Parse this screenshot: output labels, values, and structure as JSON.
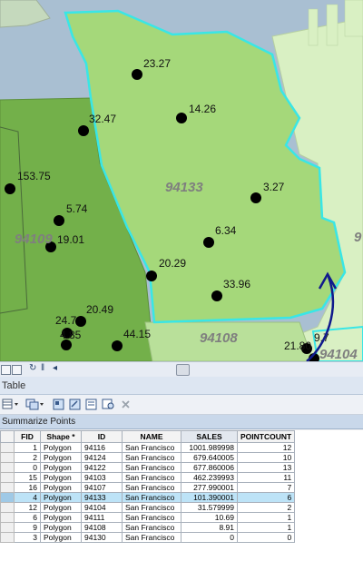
{
  "map": {
    "points": [
      {
        "label": "23.27"
      },
      {
        "label": "14.26"
      },
      {
        "label": "32.47"
      },
      {
        "label": "153.75"
      },
      {
        "label": "3.27"
      },
      {
        "label": "5.74"
      },
      {
        "label": "19.01"
      },
      {
        "label": "6.34"
      },
      {
        "label": "20.29"
      },
      {
        "label": "33.96"
      },
      {
        "label": "20.49"
      },
      {
        "label": "24.7"
      },
      {
        "label": "4.85"
      },
      {
        "label": "44.15"
      },
      {
        "label": "21.80"
      },
      {
        "label": "9.7"
      }
    ],
    "zip_labels": {
      "z94133": "94133",
      "z94109": "94109",
      "z94108": "94108",
      "z94104": "94104",
      "z9": "9"
    },
    "colors": {
      "water": "#a9bfd2",
      "land_dark": "#73b04a",
      "land_mid": "#a5d87a",
      "land_light": "#d9f0c3",
      "selection": "#39e6e6"
    }
  },
  "table": {
    "panel_title": "Table",
    "layer_tab": "Summarize Points",
    "columns": [
      "FID",
      "Shape *",
      "ID",
      "NAME",
      "SALES",
      "POINTCOUNT"
    ],
    "rows": [
      [
        "1",
        "Polygon",
        "94116",
        "San Francisco",
        "1001.989998",
        "12"
      ],
      [
        "2",
        "Polygon",
        "94124",
        "San Francisco",
        "679.640005",
        "10"
      ],
      [
        "0",
        "Polygon",
        "94122",
        "San Francisco",
        "677.860006",
        "13"
      ],
      [
        "15",
        "Polygon",
        "94103",
        "San Francisco",
        "462.239993",
        "11"
      ],
      [
        "16",
        "Polygon",
        "94107",
        "San Francisco",
        "277.990001",
        "7"
      ],
      [
        "4",
        "Polygon",
        "94133",
        "San Francisco",
        "101.390001",
        "6"
      ],
      [
        "12",
        "Polygon",
        "94104",
        "San Francisco",
        "31.579999",
        "2"
      ],
      [
        "6",
        "Polygon",
        "94111",
        "San Francisco",
        "10.69",
        "1"
      ],
      [
        "9",
        "Polygon",
        "94108",
        "San Francisco",
        "8.91",
        "1"
      ],
      [
        "3",
        "Polygon",
        "94130",
        "San Francisco",
        "0",
        "0"
      ]
    ],
    "highlighted_fid": "4"
  },
  "icons": {
    "toolbar": [
      "layout-view-icon",
      "data-view-icon",
      "refresh-icon",
      "pause-icon",
      "scroll-left-icon"
    ],
    "table_tools": [
      "table-options-icon",
      "related-tables-icon",
      "select-by-attributes-icon",
      "switch-selection-icon",
      "clear-selection-icon",
      "zoom-to-selected-icon",
      "delete-selected-icon"
    ]
  }
}
